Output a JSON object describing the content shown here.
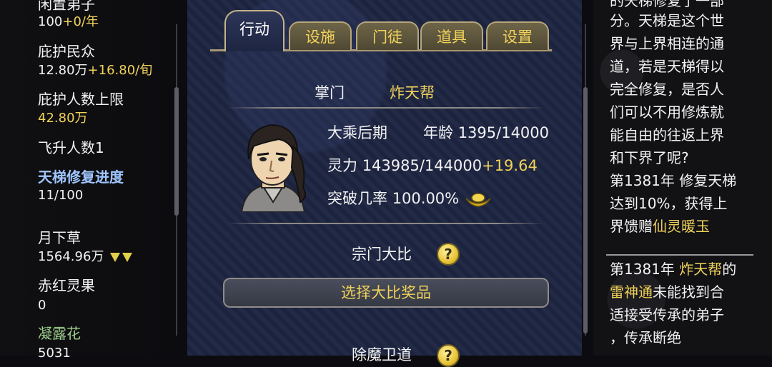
{
  "left_panel": {
    "idle_disciples": {
      "label": "闲置弟子",
      "value": "100",
      "rate": "+0/年"
    },
    "protected_people": {
      "label": "庇护民众",
      "value": "12.80万",
      "rate": "+16.80/旬"
    },
    "protect_limit": {
      "label": "庇护人数上限",
      "value": "42.80万"
    },
    "ascension_count": {
      "label": "飞升人数1"
    },
    "ladder_repair": {
      "label": "天梯修复进度",
      "value": "11/100"
    },
    "items": [
      {
        "name": "月下草",
        "value": "1564.96万",
        "indicator": "down-arrows"
      },
      {
        "name": "赤红灵果",
        "value": "0"
      },
      {
        "name": "凝露花",
        "value": "5031"
      }
    ]
  },
  "tabs": {
    "active": "行动",
    "items": [
      "设施",
      "门徒",
      "道具",
      "设置"
    ]
  },
  "leader": {
    "title_label": "掌门",
    "sect_name": "炸天帮",
    "realm": "大乘后期",
    "age_label": "年龄",
    "age_value": "1395/14000",
    "spirit_label": "灵力",
    "spirit_value": "143985/144000",
    "spirit_rate": "+19.64",
    "breakthrough_label": "突破几率",
    "breakthrough_value": "100.00%"
  },
  "tournament": {
    "label": "宗门大比",
    "help": "?",
    "button": "选择大比奖品"
  },
  "next_section": {
    "label": "除魔卫道",
    "help": "?"
  },
  "log": {
    "lines_top": [
      "的天梯修复了一部",
      "分。天梯是这个世",
      "界与上界相连的通",
      "道，若是天梯得以",
      "完全修复，是否人",
      "们可以不用修炼就",
      "能自由的往返上界",
      "和下界了呢?",
      "第1381年 修复天梯",
      "达到10%，获得上"
    ],
    "reward_prefix": "界馈赠",
    "reward_name": "仙灵暖玉",
    "entry2_prefix": "第1381年 ",
    "entry2_sect": "炸天帮",
    "entry2_of": "的",
    "entry2_skill": "雷神通",
    "entry2_rest": "未能找到合",
    "entry2_line3": "适接受传承的弟子",
    "entry2_line4": "，传承断绝"
  },
  "colors": {
    "accent_yellow": "#f0d25a",
    "highlight_blue": "#9fc6ff",
    "panel_navy": "#1d2542"
  }
}
